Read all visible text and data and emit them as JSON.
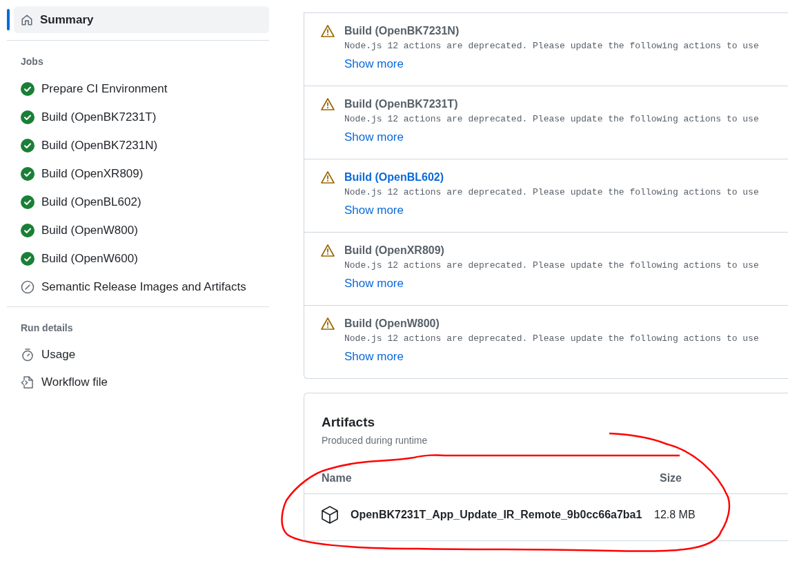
{
  "sidebar": {
    "summary": {
      "label": "Summary",
      "selected": true
    },
    "jobs_heading": "Jobs",
    "jobs": [
      {
        "label": "Prepare CI Environment",
        "kind": "success"
      },
      {
        "label": "Build (OpenBK7231T)",
        "kind": "success"
      },
      {
        "label": "Build (OpenBK7231N)",
        "kind": "success"
      },
      {
        "label": "Build (OpenXR809)",
        "kind": "success"
      },
      {
        "label": "Build (OpenBL602)",
        "kind": "success"
      },
      {
        "label": "Build (OpenW800)",
        "kind": "success"
      },
      {
        "label": "Build (OpenW600)",
        "kind": "success"
      },
      {
        "label": "Semantic Release Images and Artifacts",
        "kind": "skipped"
      }
    ],
    "run_details_heading": "Run details",
    "run_details": [
      {
        "label": "Usage",
        "kind": "usage"
      },
      {
        "label": "Workflow file",
        "kind": "workflow"
      }
    ]
  },
  "annotations": [
    {
      "title": "Build (OpenBK7231N)",
      "message": "Node.js 12 actions are deprecated. Please update the following actions to use",
      "link": "Show more",
      "highlighted": false
    },
    {
      "title": "Build (OpenBK7231T)",
      "message": "Node.js 12 actions are deprecated. Please update the following actions to use",
      "link": "Show more",
      "highlighted": false
    },
    {
      "title": "Build (OpenBL602)",
      "message": "Node.js 12 actions are deprecated. Please update the following actions to use",
      "link": "Show more",
      "highlighted": true
    },
    {
      "title": "Build (OpenXR809)",
      "message": "Node.js 12 actions are deprecated. Please update the following actions to use",
      "link": "Show more",
      "highlighted": false
    },
    {
      "title": "Build (OpenW800)",
      "message": "Node.js 12 actions are deprecated. Please update the following actions to use",
      "link": "Show more",
      "highlighted": false
    }
  ],
  "artifacts": {
    "title": "Artifacts",
    "subtitle": "Produced during runtime",
    "columns": [
      "Name",
      "Size"
    ],
    "rows": [
      {
        "name": "OpenBK7231T_App_Update_IR_Remote_9b0cc66a7ba1",
        "size": "12.8 MB"
      }
    ]
  }
}
